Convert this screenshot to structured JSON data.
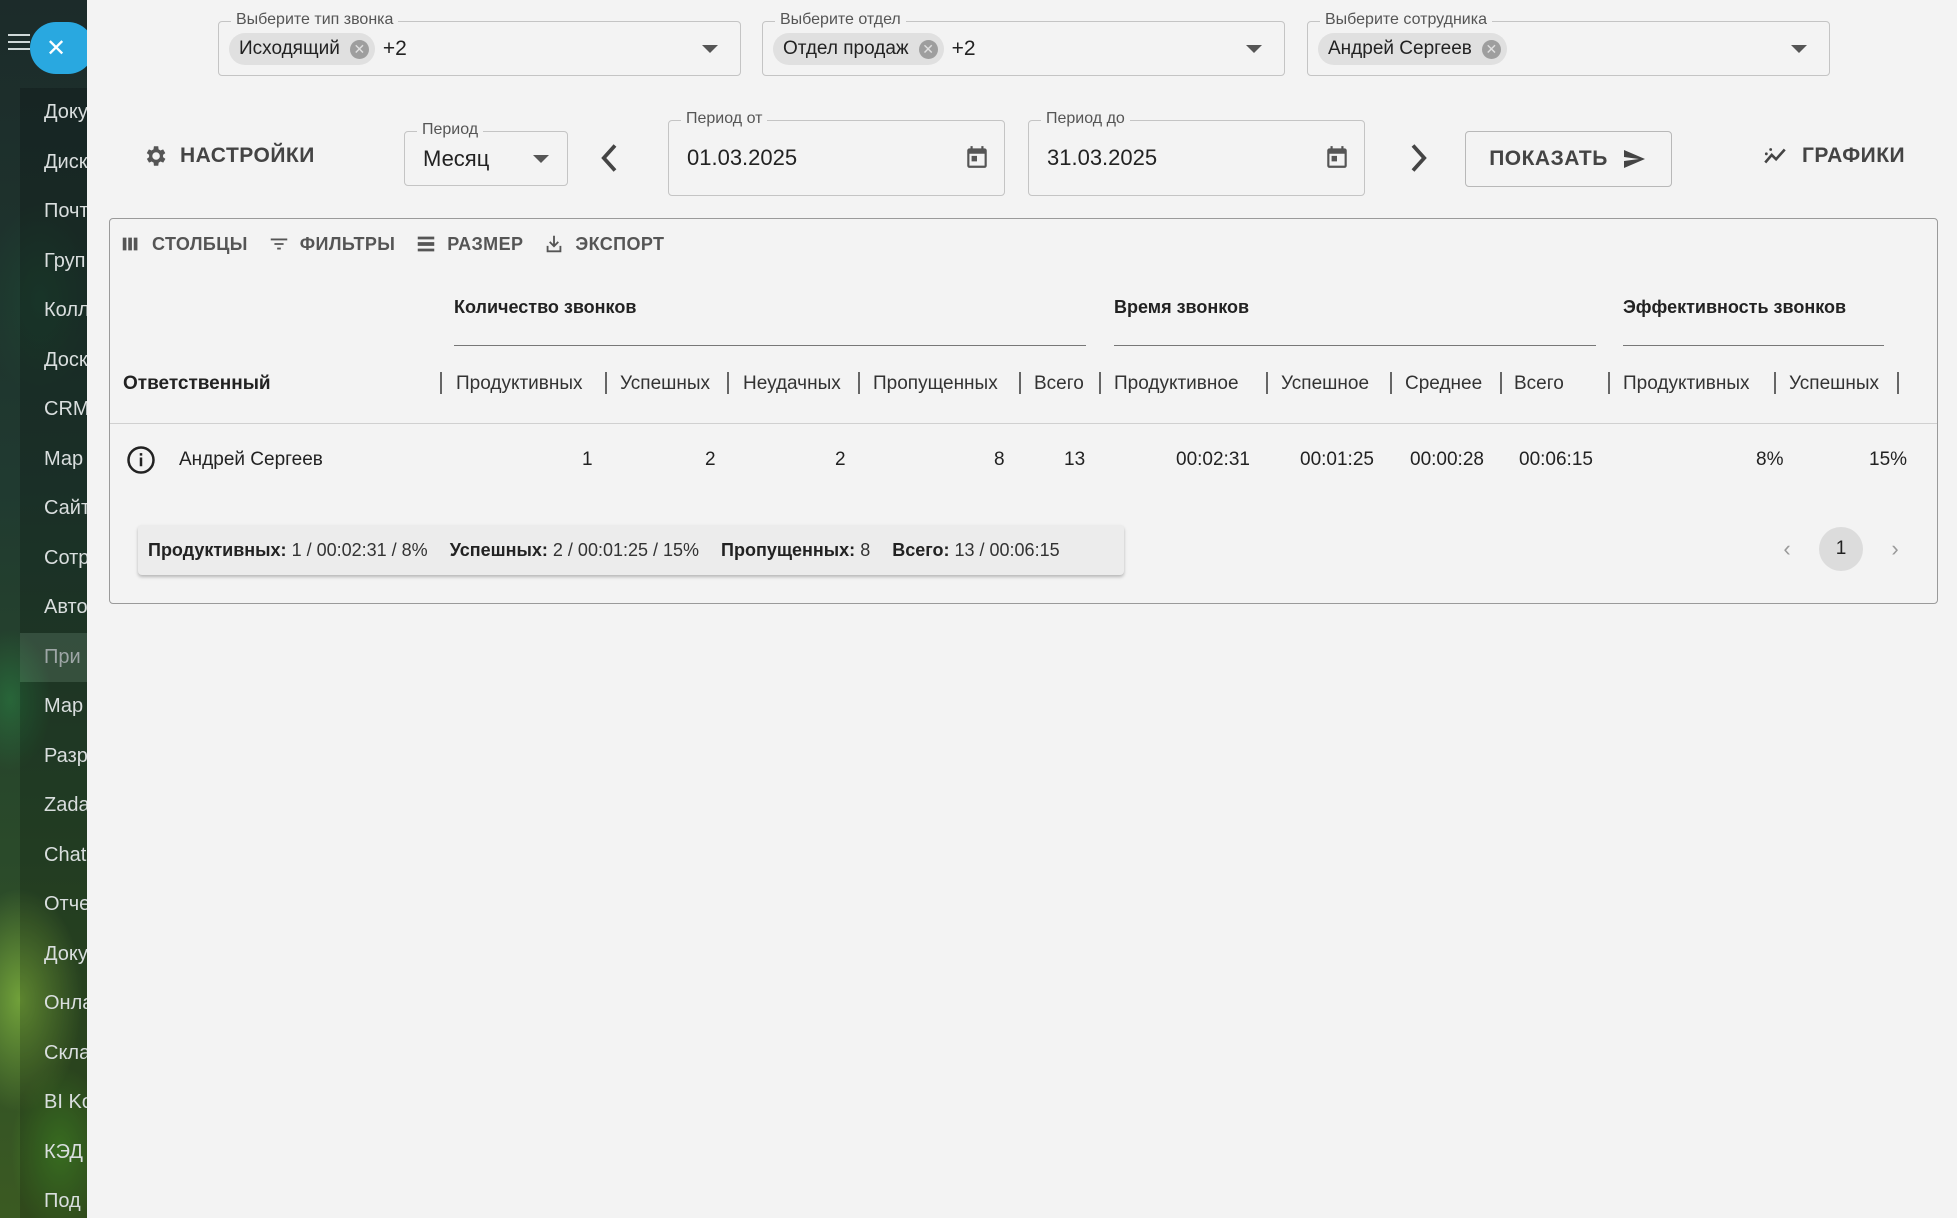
{
  "sidebar": {
    "items": [
      {
        "label": "Доку"
      },
      {
        "label": "Диск"
      },
      {
        "label": "Почт"
      },
      {
        "label": "Груп"
      },
      {
        "label": "Колл"
      },
      {
        "label": "Доск"
      },
      {
        "label": "CRM"
      },
      {
        "label": "Мар"
      },
      {
        "label": "Сайт"
      },
      {
        "label": "Сотр"
      },
      {
        "label": "Авто"
      },
      {
        "label": "При"
      },
      {
        "label": "Мар"
      },
      {
        "label": "Разр"
      },
      {
        "label": "Zada"
      },
      {
        "label": "Chat"
      },
      {
        "label": "Отче"
      },
      {
        "label": "Доку"
      },
      {
        "label": "Онла"
      },
      {
        "label": "Скла"
      },
      {
        "label": "BI Ko"
      },
      {
        "label": "КЭД"
      },
      {
        "label": "Под"
      }
    ]
  },
  "filters": {
    "call_type": {
      "legend": "Выберите тип звонка",
      "chip": "Исходящий",
      "more": "+2"
    },
    "department": {
      "legend": "Выберите отдел",
      "chip": "Отдел продаж",
      "more": "+2"
    },
    "employee": {
      "legend": "Выберите сотрудника",
      "chip": "Андрей Сергеев",
      "more": ""
    }
  },
  "controls": {
    "settings_label": "НАСТРОЙКИ",
    "period": {
      "legend": "Период",
      "value": "Месяц"
    },
    "date_from": {
      "legend": "Период от",
      "value": "01.03.2025"
    },
    "date_to": {
      "legend": "Период до",
      "value": "31.03.2025"
    },
    "show_label": "ПОКАЗАТЬ",
    "charts_label": "ГРАФИКИ"
  },
  "table": {
    "toolbar": {
      "columns": "СТОЛБЦЫ",
      "filters": "ФИЛЬТРЫ",
      "density": "РАЗМЕР",
      "export": "ЭКСПОРТ"
    },
    "groups": {
      "count": "Количество звонков",
      "time": "Время звонков",
      "efficiency": "Эффективность звонков"
    },
    "headers": {
      "responsible": "Ответственный",
      "count_productive": "Продуктивных",
      "count_successful": "Успешных",
      "count_failed": "Неудачных",
      "count_missed": "Пропущенных",
      "count_total": "Всего",
      "time_productive": "Продуктивное",
      "time_successful": "Успешное",
      "time_average": "Среднее",
      "time_total": "Всего",
      "eff_productive": "Продуктивных",
      "eff_successful": "Успешных"
    },
    "rows": [
      {
        "responsible": "Андрей Сергеев",
        "count_productive": "1",
        "count_successful": "2",
        "count_failed": "2",
        "count_missed": "8",
        "count_total": "13",
        "time_productive": "00:02:31",
        "time_successful": "00:01:25",
        "time_average": "00:00:28",
        "time_total": "00:06:15",
        "eff_productive": "8%",
        "eff_successful": "15%"
      }
    ],
    "summary": {
      "productive_label": "Продуктивных:",
      "productive_value": "1 / 00:02:31 / 8%",
      "successful_label": "Успешных:",
      "successful_value": "2 / 00:01:25 / 15%",
      "missed_label": "Пропущенных:",
      "missed_value": "8",
      "total_label": "Всего:",
      "total_value": "13 / 00:06:15"
    },
    "pagination": {
      "current_page": "1"
    }
  },
  "colors": {
    "accent": "#29a8e0",
    "card_border": "#9a9a9a",
    "text": "#222222"
  }
}
